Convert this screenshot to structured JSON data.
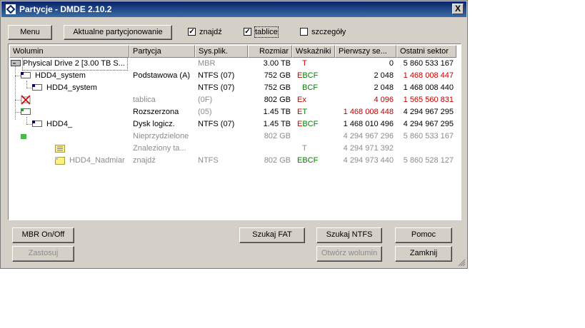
{
  "window": {
    "title": "Partycje - DMDE 2.10.2",
    "close_glyph": "X"
  },
  "toolbar": {
    "menu_label": "Menu",
    "current_partitioning_label": "Aktualne partycjonowanie",
    "found_label": "znajdź",
    "found_checked": true,
    "tables_label": "tablice",
    "tables_checked": true,
    "details_label": "szczegóły",
    "details_checked": false,
    "check_glyph": "✓"
  },
  "columns": [
    "Wolumin",
    "Partycja",
    "Sys.plik.",
    "Rozmiar",
    "Wskaźniki",
    "Pierwszy se...",
    "Ostatni sektor"
  ],
  "rows": [
    {
      "volume": "Physical Drive 2 [3.00 TB S...",
      "partition": "",
      "fs": "MBR",
      "size": "3.00 TB",
      "flags": "T",
      "first": "0",
      "last": "5 860 533 167"
    },
    {
      "volume": "HDD4_system",
      "partition": "Podstawowa (A)",
      "fs": "NTFS (07)",
      "size": "752 GB",
      "flags": "EBCF",
      "first": "2 048",
      "last": "1 468 008 447"
    },
    {
      "volume": "HDD4_system",
      "partition": "",
      "fs": "NTFS (07)",
      "size": "752 GB",
      "flags": "BCF",
      "first": "2 048",
      "last": "1 468 008 440"
    },
    {
      "volume": "",
      "partition": "tablica",
      "fs": "(0F)",
      "size": "802 GB",
      "flags": "Ex",
      "first": "4 096",
      "last": "1 565 560 831"
    },
    {
      "volume": "",
      "partition": "Rozszerzona",
      "fs": "(05)",
      "size": "1.45 TB",
      "flags": "ET",
      "first": "1 468 008 448",
      "last": "4 294 967 295"
    },
    {
      "volume": "HDD4_",
      "partition": "Dysk logicz.",
      "fs": "NTFS (07)",
      "size": "1.45 TB",
      "flags": "EBCF",
      "first": "1 468 010 496",
      "last": "4 294 967 295"
    },
    {
      "volume": "",
      "partition": "Nieprzydzielone",
      "fs": "",
      "size": "802 GB",
      "flags": "",
      "first": "4 294 967 296",
      "last": "5 860 533 167"
    },
    {
      "volume": "",
      "partition": "Znaleziony ta...",
      "fs": "",
      "size": "",
      "flags": "T",
      "first": "4 294 971 392",
      "last": ""
    },
    {
      "volume": "HDD4_Nadmiar",
      "partition": "znajdź",
      "fs": "NTFS",
      "size": "802 GB",
      "flags": "EBCF",
      "first": "4 294 973 440",
      "last": "5 860 528 127"
    }
  ],
  "buttons": {
    "mbr_onoff": "MBR On/Off",
    "apply": "Zastosuj",
    "search_fat": "Szukaj FAT",
    "search_ntfs": "Szukaj NTFS",
    "help": "Pomoc",
    "open_volume": "Otwórz wolumin",
    "close": "Zamknij"
  },
  "colors": {
    "red": "#c00000",
    "green": "#008000",
    "gray": "#8c8c8c",
    "title_start": "#0a246a",
    "title_end": "#3a6ea5"
  }
}
